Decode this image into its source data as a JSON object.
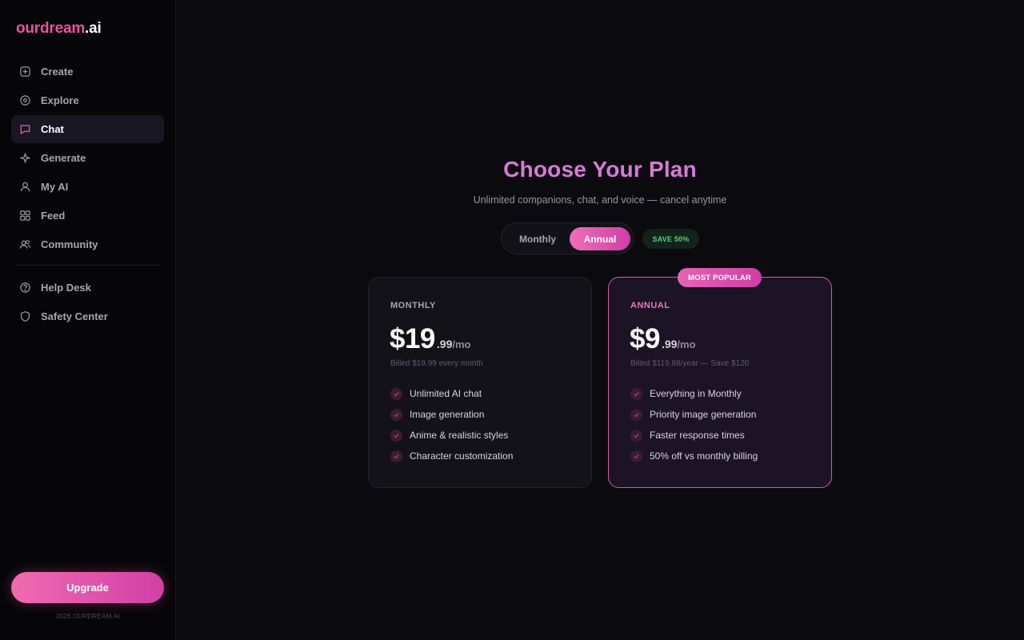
{
  "logo": {
    "brand": "ourdream",
    "tld": ".ai"
  },
  "sidebar": {
    "items": [
      {
        "label": "Create",
        "icon": "plus-square-icon"
      },
      {
        "label": "Explore",
        "icon": "compass-icon"
      },
      {
        "label": "Chat",
        "icon": "chat-bubble-icon",
        "active": true
      },
      {
        "label": "Generate",
        "icon": "sparkle-icon"
      },
      {
        "label": "My AI",
        "icon": "user-icon"
      },
      {
        "label": "Feed",
        "icon": "grid-icon"
      },
      {
        "label": "Community",
        "icon": "users-icon"
      }
    ],
    "secondary_items": [
      {
        "label": "Help Desk",
        "icon": "help-circle-icon"
      },
      {
        "label": "Safety Center",
        "icon": "shield-icon"
      }
    ],
    "upgrade_label": "Upgrade",
    "copyright": "2026 OURDREAM.AI"
  },
  "main": {
    "title": "Choose Your Plan",
    "subtitle": "Unlimited companions, chat, and voice — cancel anytime",
    "toggle": {
      "monthly": "Monthly",
      "annual": "Annual",
      "selected": "Annual"
    },
    "save_badge": "SAVE 50%",
    "popular_badge": "MOST POPULAR",
    "plans": [
      {
        "name": "MONTHLY",
        "price_major": "$19",
        "price_minor": ".99",
        "per": "/mo",
        "billed": "Billed $19.99 every month",
        "features": [
          "Unlimited AI chat",
          "Image generation",
          "Anime & realistic styles",
          "Character customization"
        ]
      },
      {
        "name": "ANNUAL",
        "price_major": "$9",
        "price_minor": ".99",
        "per": "/mo",
        "billed": "Billed $119.88/year — Save $120",
        "features": [
          "Everything in Monthly",
          "Priority image generation",
          "Faster response times",
          "50% off vs monthly billing"
        ]
      }
    ]
  },
  "colors": {
    "accent_pink": "#e8549e",
    "title_purple": "#d77bd6",
    "save_green": "#4fd37e",
    "background": "#0b0a0e"
  }
}
